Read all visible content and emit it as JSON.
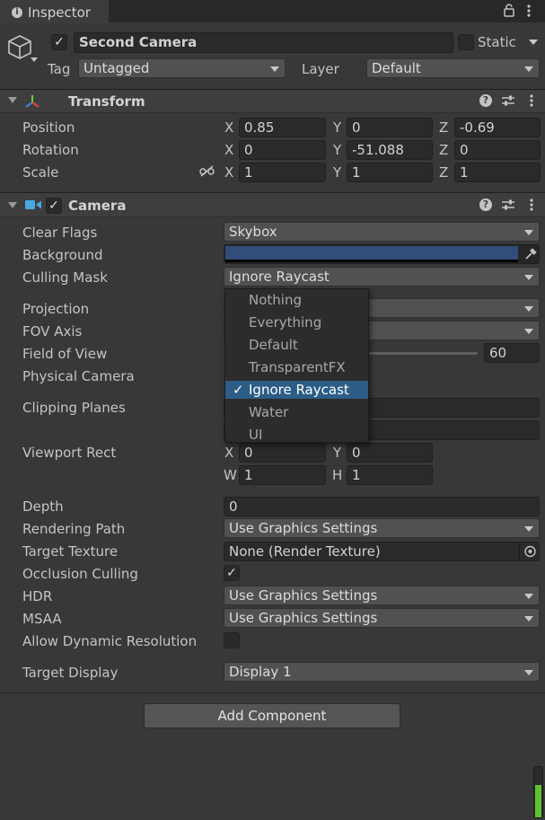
{
  "tab": {
    "icon": "info-icon",
    "title": "Inspector"
  },
  "object": {
    "name": "Second Camera",
    "static_label": "Static",
    "tag_label": "Tag",
    "tag_value": "Untagged",
    "layer_label": "Layer",
    "layer_value": "Default"
  },
  "transform": {
    "title": "Transform",
    "position": {
      "label": "Position",
      "x": "0.85",
      "y": "0",
      "z": "-0.69"
    },
    "rotation": {
      "label": "Rotation",
      "x": "0",
      "y": "-51.088",
      "z": "0"
    },
    "scale": {
      "label": "Scale",
      "x": "1",
      "y": "1",
      "z": "1"
    },
    "axis_x": "X",
    "axis_y": "Y",
    "axis_z": "Z"
  },
  "camera": {
    "title": "Camera",
    "clear_flags": {
      "label": "Clear Flags",
      "value": "Skybox"
    },
    "background": {
      "label": "Background",
      "color": "#314d79"
    },
    "culling_mask": {
      "label": "Culling Mask",
      "value": "Ignore Raycast"
    },
    "projection": {
      "label": "Projection"
    },
    "fov_axis": {
      "label": "FOV Axis"
    },
    "field_of_view": {
      "label": "Field of View",
      "value": "60"
    },
    "physical_camera": {
      "label": "Physical Camera"
    },
    "clipping_planes": {
      "label": "Clipping Planes"
    },
    "viewport_rect": {
      "label": "Viewport Rect",
      "x": "0",
      "y": "0",
      "w": "1",
      "h": "1",
      "axis_x": "X",
      "axis_y": "Y",
      "axis_w": "W",
      "axis_h": "H"
    },
    "depth": {
      "label": "Depth",
      "value": "0"
    },
    "rendering_path": {
      "label": "Rendering Path",
      "value": "Use Graphics Settings"
    },
    "target_texture": {
      "label": "Target Texture",
      "value": "None (Render Texture)"
    },
    "occlusion_culling": {
      "label": "Occlusion Culling",
      "checked": true
    },
    "hdr": {
      "label": "HDR",
      "value": "Use Graphics Settings"
    },
    "msaa": {
      "label": "MSAA",
      "value": "Use Graphics Settings"
    },
    "allow_dynamic_resolution": {
      "label": "Allow Dynamic Resolution",
      "checked": false
    },
    "target_display": {
      "label": "Target Display",
      "value": "Display 1"
    }
  },
  "culling_menu": {
    "items": [
      "Nothing",
      "Everything",
      "Default",
      "TransparentFX",
      "Ignore Raycast",
      "Water",
      "UI"
    ],
    "selected": "Ignore Raycast",
    "checkmark": "✓"
  },
  "add_component": "Add Component",
  "colors": {
    "accent": "#2c5d87",
    "bg": "#383838",
    "header": "#3e3e3e"
  }
}
